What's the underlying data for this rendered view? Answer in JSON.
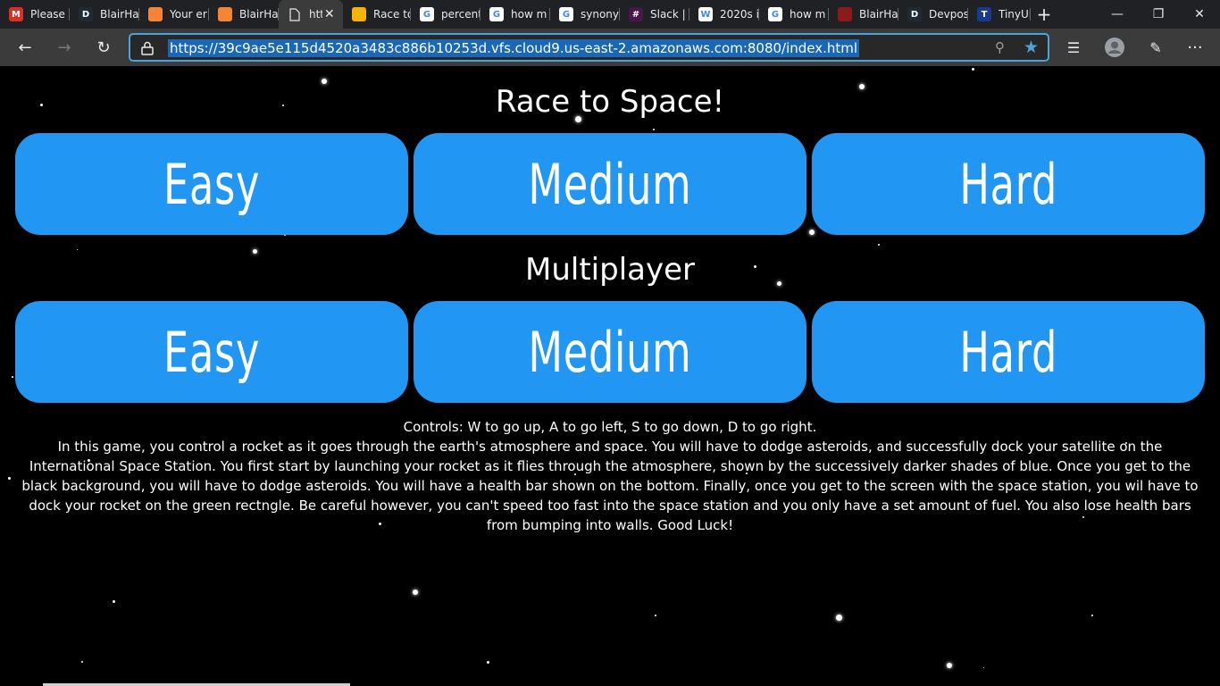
{
  "browser": {
    "tabs": [
      {
        "title": "Please",
        "icon": "gmail-icon",
        "color": "#d93025",
        "glyph": "M",
        "active": false
      },
      {
        "title": "BlairHa",
        "icon": "devpost-icon",
        "color": "#1e2a38",
        "glyph": "D",
        "active": false
      },
      {
        "title": "Your er",
        "icon": "aws-icon",
        "color": "#f58536",
        "glyph": "",
        "active": false
      },
      {
        "title": "BlairHa",
        "icon": "aws-icon",
        "color": "#f58536",
        "glyph": "",
        "active": false
      },
      {
        "title": "htt",
        "icon": "page-icon",
        "color": "",
        "glyph": "",
        "active": true
      },
      {
        "title": "Race to",
        "icon": "slides-icon",
        "color": "#f4b400",
        "glyph": "",
        "active": false
      },
      {
        "title": "percent",
        "icon": "google-icon",
        "color": "#ffffff",
        "glyph": "G",
        "active": false
      },
      {
        "title": "how m",
        "icon": "google-icon",
        "color": "#ffffff",
        "glyph": "G",
        "active": false
      },
      {
        "title": "synony",
        "icon": "google-icon",
        "color": "#ffffff",
        "glyph": "G",
        "active": false
      },
      {
        "title": "Slack |",
        "icon": "slack-icon",
        "color": "#4a154b",
        "glyph": "#",
        "active": false
      },
      {
        "title": "2020s i",
        "icon": "wikipedia-icon",
        "color": "#ffffff",
        "glyph": "W",
        "active": false
      },
      {
        "title": "how m",
        "icon": "google-icon",
        "color": "#ffffff",
        "glyph": "G",
        "active": false
      },
      {
        "title": "BlairHa",
        "icon": "github-icon",
        "color": "#8b1a1a",
        "glyph": "",
        "active": false
      },
      {
        "title": "Devpos",
        "icon": "devpost-icon",
        "color": "#1e2a38",
        "glyph": "D",
        "active": false
      },
      {
        "title": "TinyUR",
        "icon": "tinyurl-icon",
        "color": "#1a3a8f",
        "glyph": "T",
        "active": false
      }
    ],
    "url": "https://39c9ae5e115d4520a3483c886b10253d.vfs.cloud9.us-east-2.amazonaws.com:8080/index.html"
  },
  "page": {
    "title": "Race to Space!",
    "single_player": {
      "easy": "Easy",
      "medium": "Medium",
      "hard": "Hard"
    },
    "multiplayer_heading": "Multiplayer",
    "multiplayer": {
      "easy": "Easy",
      "medium": "Medium",
      "hard": "Hard"
    },
    "controls": "Controls: W to go up, A to go left, S to go down, D to go right.",
    "description": "In this game, you control a rocket as it goes through the earth's atmosphere and space. You will have to dodge asteroids, and successfully dock your satellite on the International Space Station. You first start by launching your rocket as it flies through the atmosphere, shown by the successively darker shades of blue. Once you get to the black background, you will have to dodge asteroids. You will have a health bar shown on the bottom. Finally, once you get to the screen with the space station, you wil have to dock your rocket on the green rectngle. Be careful however, you can't speed too fast into the space station and you only have a set amount of fuel. You also lose health bars from bumping into walls. Good Luck!"
  },
  "colors": {
    "button": "#2196f3",
    "background": "#000000",
    "accent": "#4aa3df"
  }
}
